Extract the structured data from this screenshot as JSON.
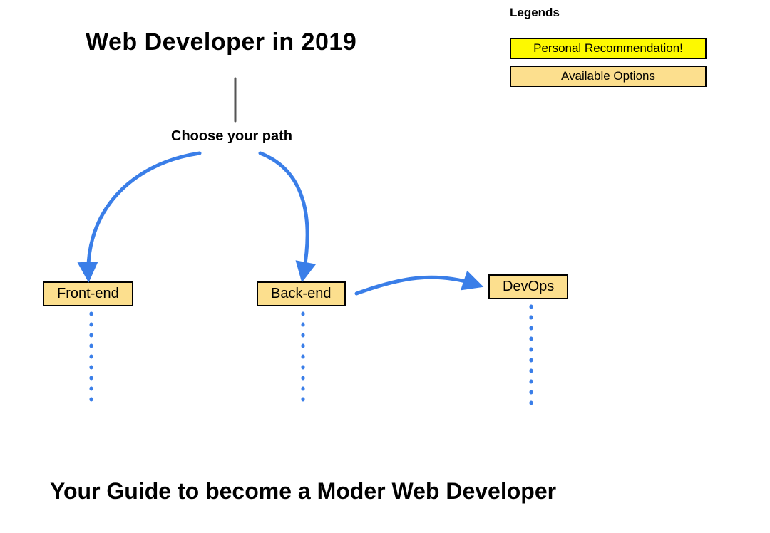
{
  "title": "Web Developer in 2019",
  "choose_label": "Choose your path",
  "legend": {
    "heading": "Legends",
    "items": [
      {
        "label": "Personal Recommendation!",
        "kind": "yellow"
      },
      {
        "label": "Available Options",
        "kind": "orange"
      }
    ]
  },
  "nodes": {
    "frontend": "Front-end",
    "backend": "Back-end",
    "devops": "DevOps"
  },
  "subtitle": "Your Guide to become a Moder Web Developer",
  "colors": {
    "arrow_blue": "#3a7ee8",
    "line_gray": "#555555",
    "node_fill": "#fcdf8e",
    "highlight": "#fdf900"
  }
}
